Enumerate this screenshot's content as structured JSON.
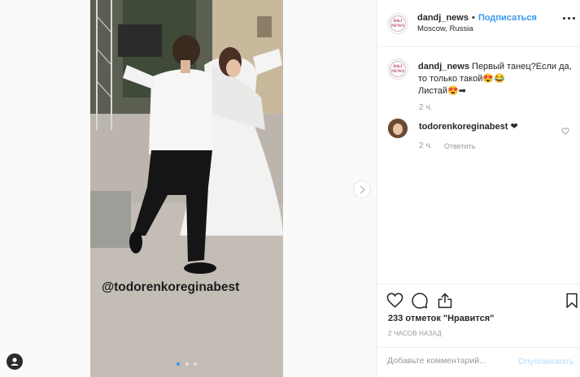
{
  "post": {
    "username": "dandj_news",
    "separator": "•",
    "follow_label": "Подписаться",
    "location": "Moscow, Russia",
    "avatar_line1": "D&J",
    "avatar_line2": "NEWS"
  },
  "media": {
    "overlay_tag": "@todorenkoreginabest",
    "slide_count": 3,
    "active_slide": 1
  },
  "caption": {
    "username": "dandj_news",
    "text": "Первый танец?Если да,\nто только такой😍😂\nЛистай😍➡",
    "time": "2 ч."
  },
  "comment": {
    "username": "todorenkoreginabest",
    "text": "❤",
    "time": "2 ч.",
    "reply_label": "Ответить"
  },
  "engagement": {
    "likes_count": "233",
    "likes_label": "отметок \"Нравится\"",
    "posted_ago": "2 ЧАСОВ НАЗАД"
  },
  "add_comment": {
    "placeholder": "Добавьте комментарий...",
    "post_label": "Опубликовать"
  },
  "icons": {
    "like": "heart-outline-icon",
    "comment": "speech-bubble-icon",
    "share": "share-arrow-icon",
    "save": "bookmark-icon",
    "next": "chevron-right-icon",
    "account": "user-circle-icon"
  },
  "colors": {
    "link_blue": "#3897f0",
    "post_disabled": "#b2dffc",
    "muted_text": "#999999"
  }
}
